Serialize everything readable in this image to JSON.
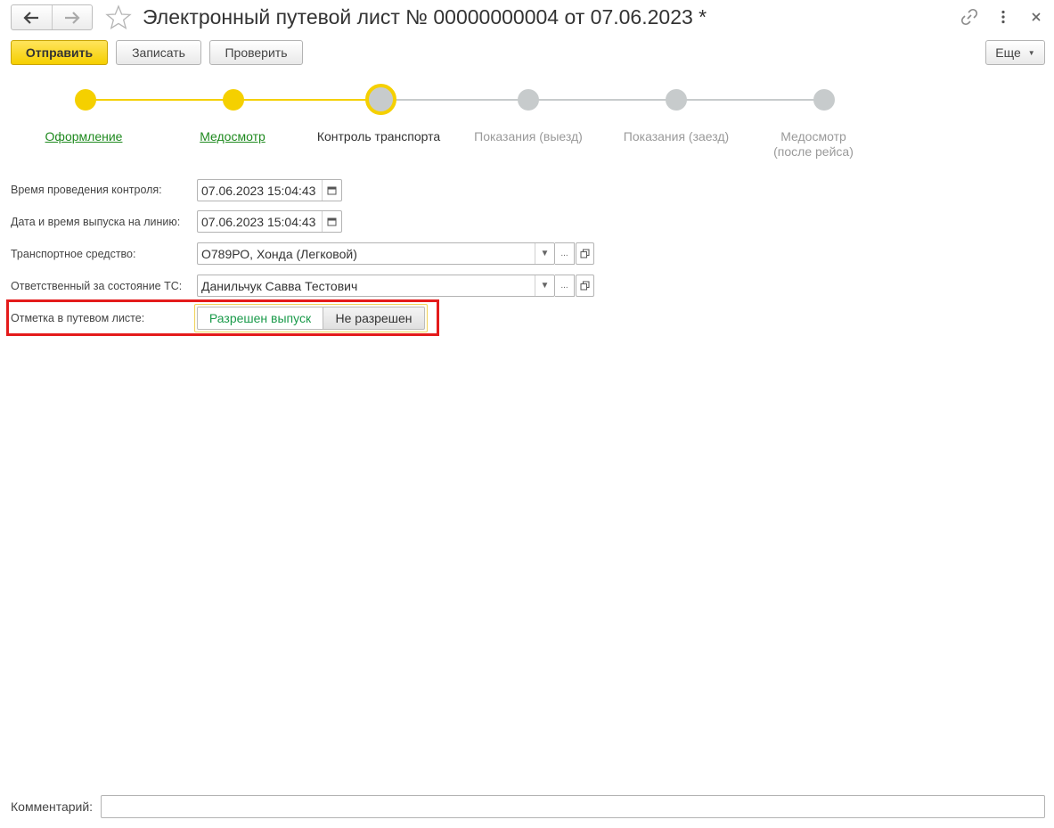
{
  "header": {
    "back_icon": "arrow-left-icon",
    "forward_icon": "arrow-right-icon",
    "favorite_icon": "star-icon",
    "title": "Электронный путевой лист № 00000000004 от 07.06.2023 *",
    "link_icon": "link-icon",
    "menu_icon": "vertical-dots-icon",
    "close_icon": "close-icon"
  },
  "toolbar": {
    "send_label": "Отправить",
    "save_label": "Записать",
    "check_label": "Проверить",
    "more_label": "Еще"
  },
  "steps": [
    {
      "label": "Оформление",
      "state": "done"
    },
    {
      "label": "Медосмотр",
      "state": "done"
    },
    {
      "label": "Контроль транспорта",
      "state": "current"
    },
    {
      "label": "Показания (выезд)",
      "state": "future"
    },
    {
      "label": "Показания (заезд)",
      "state": "future"
    },
    {
      "label": "Медосмотр\n(после рейса)",
      "state": "future"
    }
  ],
  "form": {
    "control_time": {
      "label": "Время проведения контроля:",
      "value": "07.06.2023 15:04:43"
    },
    "release_time": {
      "label": "Дата и время выпуска на линию:",
      "value": "07.06.2023 15:04:43"
    },
    "vehicle": {
      "label": "Транспортное средство:",
      "value": "О789РО, Хонда  (Легковой)"
    },
    "responsible": {
      "label": "Ответственный за состояние ТС:",
      "value": "Данильчук Савва Тестович"
    },
    "mark": {
      "label": "Отметка в путевом листе:",
      "option_allowed": "Разрешен выпуск",
      "option_denied": "Не разрешен",
      "selected": "Разрешен выпуск"
    }
  },
  "comment": {
    "label": "Комментарий:",
    "value": ""
  },
  "colors": {
    "accent_yellow": "#f5d000",
    "step_future": "#c7cbcc",
    "link_green": "#1f8a1f",
    "highlight_red": "#e41b1b"
  }
}
